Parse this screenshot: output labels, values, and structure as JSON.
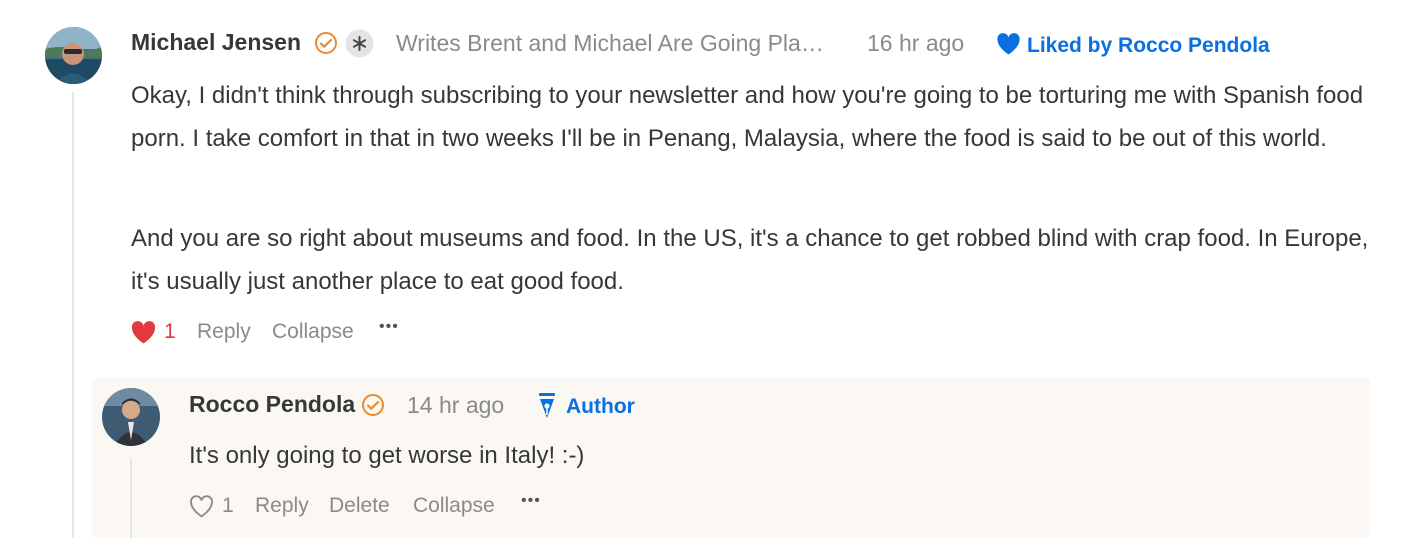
{
  "comment": {
    "author": "Michael Jensen",
    "publication": "Writes Brent and Michael Are Going Pla…",
    "time": "16 hr ago",
    "liked_by": "Liked by Rocco Pendola",
    "paragraphs": [
      "Okay, I didn't think through subscribing to your newsletter and how you're going to be torturing me with Spanish food porn. I take comfort in that in two weeks I'll be in Penang, Malaysia, where the food is said to be out of this world.",
      "And you are so right about museums and food. In the US, it's a chance to get robbed blind with crap food. In Europe, it's usually just another place to eat good food."
    ],
    "like_count": "1",
    "actions": {
      "reply": "Reply",
      "collapse": "Collapse",
      "more": "•••"
    }
  },
  "reply": {
    "author": "Rocco Pendola",
    "time": "14 hr ago",
    "badge": "Author",
    "text": "It's only going to get worse in Italy! :-)",
    "like_count": "1",
    "actions": {
      "reply": "Reply",
      "delete": "Delete",
      "collapse": "Collapse",
      "more": "•••"
    }
  },
  "colors": {
    "accent_blue": "#0a6fe0",
    "heart_red": "#e0393e",
    "verified_orange": "#ea8a2f",
    "reply_bg": "#fbf8f3"
  }
}
